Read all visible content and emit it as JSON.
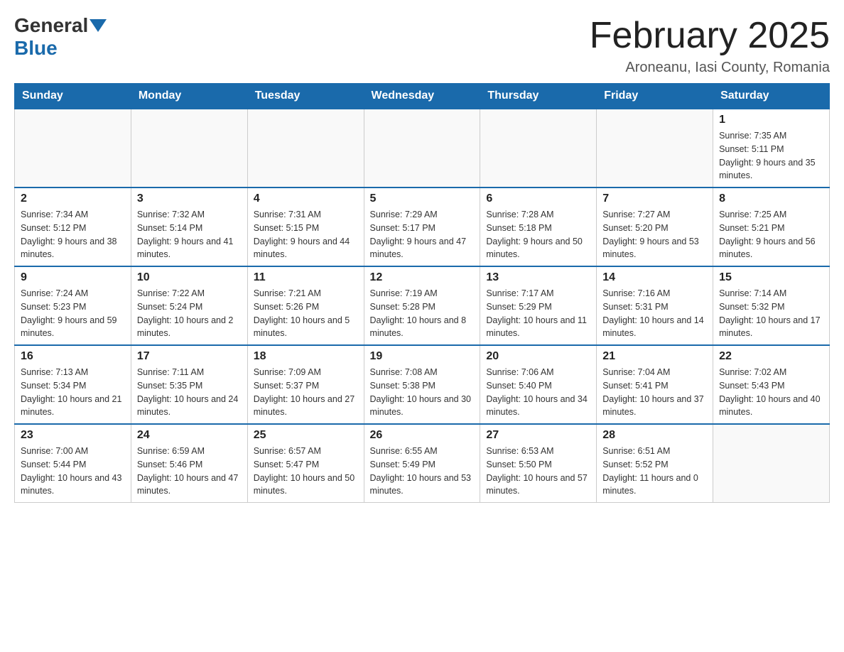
{
  "header": {
    "logo_general": "General",
    "logo_blue": "Blue",
    "title": "February 2025",
    "subtitle": "Aroneanu, Iasi County, Romania"
  },
  "weekdays": [
    "Sunday",
    "Monday",
    "Tuesday",
    "Wednesday",
    "Thursday",
    "Friday",
    "Saturday"
  ],
  "weeks": [
    [
      {
        "day": "",
        "sunrise": "",
        "sunset": "",
        "daylight": ""
      },
      {
        "day": "",
        "sunrise": "",
        "sunset": "",
        "daylight": ""
      },
      {
        "day": "",
        "sunrise": "",
        "sunset": "",
        "daylight": ""
      },
      {
        "day": "",
        "sunrise": "",
        "sunset": "",
        "daylight": ""
      },
      {
        "day": "",
        "sunrise": "",
        "sunset": "",
        "daylight": ""
      },
      {
        "day": "",
        "sunrise": "",
        "sunset": "",
        "daylight": ""
      },
      {
        "day": "1",
        "sunrise": "Sunrise: 7:35 AM",
        "sunset": "Sunset: 5:11 PM",
        "daylight": "Daylight: 9 hours and 35 minutes."
      }
    ],
    [
      {
        "day": "2",
        "sunrise": "Sunrise: 7:34 AM",
        "sunset": "Sunset: 5:12 PM",
        "daylight": "Daylight: 9 hours and 38 minutes."
      },
      {
        "day": "3",
        "sunrise": "Sunrise: 7:32 AM",
        "sunset": "Sunset: 5:14 PM",
        "daylight": "Daylight: 9 hours and 41 minutes."
      },
      {
        "day": "4",
        "sunrise": "Sunrise: 7:31 AM",
        "sunset": "Sunset: 5:15 PM",
        "daylight": "Daylight: 9 hours and 44 minutes."
      },
      {
        "day": "5",
        "sunrise": "Sunrise: 7:29 AM",
        "sunset": "Sunset: 5:17 PM",
        "daylight": "Daylight: 9 hours and 47 minutes."
      },
      {
        "day": "6",
        "sunrise": "Sunrise: 7:28 AM",
        "sunset": "Sunset: 5:18 PM",
        "daylight": "Daylight: 9 hours and 50 minutes."
      },
      {
        "day": "7",
        "sunrise": "Sunrise: 7:27 AM",
        "sunset": "Sunset: 5:20 PM",
        "daylight": "Daylight: 9 hours and 53 minutes."
      },
      {
        "day": "8",
        "sunrise": "Sunrise: 7:25 AM",
        "sunset": "Sunset: 5:21 PM",
        "daylight": "Daylight: 9 hours and 56 minutes."
      }
    ],
    [
      {
        "day": "9",
        "sunrise": "Sunrise: 7:24 AM",
        "sunset": "Sunset: 5:23 PM",
        "daylight": "Daylight: 9 hours and 59 minutes."
      },
      {
        "day": "10",
        "sunrise": "Sunrise: 7:22 AM",
        "sunset": "Sunset: 5:24 PM",
        "daylight": "Daylight: 10 hours and 2 minutes."
      },
      {
        "day": "11",
        "sunrise": "Sunrise: 7:21 AM",
        "sunset": "Sunset: 5:26 PM",
        "daylight": "Daylight: 10 hours and 5 minutes."
      },
      {
        "day": "12",
        "sunrise": "Sunrise: 7:19 AM",
        "sunset": "Sunset: 5:28 PM",
        "daylight": "Daylight: 10 hours and 8 minutes."
      },
      {
        "day": "13",
        "sunrise": "Sunrise: 7:17 AM",
        "sunset": "Sunset: 5:29 PM",
        "daylight": "Daylight: 10 hours and 11 minutes."
      },
      {
        "day": "14",
        "sunrise": "Sunrise: 7:16 AM",
        "sunset": "Sunset: 5:31 PM",
        "daylight": "Daylight: 10 hours and 14 minutes."
      },
      {
        "day": "15",
        "sunrise": "Sunrise: 7:14 AM",
        "sunset": "Sunset: 5:32 PM",
        "daylight": "Daylight: 10 hours and 17 minutes."
      }
    ],
    [
      {
        "day": "16",
        "sunrise": "Sunrise: 7:13 AM",
        "sunset": "Sunset: 5:34 PM",
        "daylight": "Daylight: 10 hours and 21 minutes."
      },
      {
        "day": "17",
        "sunrise": "Sunrise: 7:11 AM",
        "sunset": "Sunset: 5:35 PM",
        "daylight": "Daylight: 10 hours and 24 minutes."
      },
      {
        "day": "18",
        "sunrise": "Sunrise: 7:09 AM",
        "sunset": "Sunset: 5:37 PM",
        "daylight": "Daylight: 10 hours and 27 minutes."
      },
      {
        "day": "19",
        "sunrise": "Sunrise: 7:08 AM",
        "sunset": "Sunset: 5:38 PM",
        "daylight": "Daylight: 10 hours and 30 minutes."
      },
      {
        "day": "20",
        "sunrise": "Sunrise: 7:06 AM",
        "sunset": "Sunset: 5:40 PM",
        "daylight": "Daylight: 10 hours and 34 minutes."
      },
      {
        "day": "21",
        "sunrise": "Sunrise: 7:04 AM",
        "sunset": "Sunset: 5:41 PM",
        "daylight": "Daylight: 10 hours and 37 minutes."
      },
      {
        "day": "22",
        "sunrise": "Sunrise: 7:02 AM",
        "sunset": "Sunset: 5:43 PM",
        "daylight": "Daylight: 10 hours and 40 minutes."
      }
    ],
    [
      {
        "day": "23",
        "sunrise": "Sunrise: 7:00 AM",
        "sunset": "Sunset: 5:44 PM",
        "daylight": "Daylight: 10 hours and 43 minutes."
      },
      {
        "day": "24",
        "sunrise": "Sunrise: 6:59 AM",
        "sunset": "Sunset: 5:46 PM",
        "daylight": "Daylight: 10 hours and 47 minutes."
      },
      {
        "day": "25",
        "sunrise": "Sunrise: 6:57 AM",
        "sunset": "Sunset: 5:47 PM",
        "daylight": "Daylight: 10 hours and 50 minutes."
      },
      {
        "day": "26",
        "sunrise": "Sunrise: 6:55 AM",
        "sunset": "Sunset: 5:49 PM",
        "daylight": "Daylight: 10 hours and 53 minutes."
      },
      {
        "day": "27",
        "sunrise": "Sunrise: 6:53 AM",
        "sunset": "Sunset: 5:50 PM",
        "daylight": "Daylight: 10 hours and 57 minutes."
      },
      {
        "day": "28",
        "sunrise": "Sunrise: 6:51 AM",
        "sunset": "Sunset: 5:52 PM",
        "daylight": "Daylight: 11 hours and 0 minutes."
      },
      {
        "day": "",
        "sunrise": "",
        "sunset": "",
        "daylight": ""
      }
    ]
  ]
}
